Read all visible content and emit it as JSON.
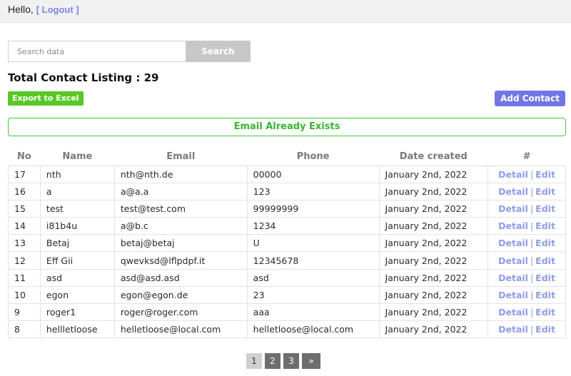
{
  "header": {
    "greeting": "Hello,",
    "logout_open": "[",
    "logout_label": "Logout",
    "logout_close": "]"
  },
  "search": {
    "placeholder": "Search data",
    "value": "",
    "button_label": "Search"
  },
  "total": {
    "label": "Total Contact Listing : 29"
  },
  "actions": {
    "export_label": "Export to Excel",
    "add_label": "Add Contact"
  },
  "alert": {
    "message": "Email Already Exists"
  },
  "table": {
    "headers": [
      "No",
      "Name",
      "Email",
      "Phone",
      "Date created",
      "#"
    ],
    "detail_label": "Detail",
    "separator": "|",
    "edit_label": "Edit",
    "rows": [
      {
        "no": "17",
        "name": "nth",
        "email": "nth@nth.de",
        "phone": "00000",
        "date": "January 2nd, 2022"
      },
      {
        "no": "16",
        "name": "a",
        "email": "a@a.a",
        "phone": "123",
        "date": "January 2nd, 2022"
      },
      {
        "no": "15",
        "name": "test",
        "email": "test@test.com",
        "phone": "99999999",
        "date": "January 2nd, 2022"
      },
      {
        "no": "14",
        "name": "i81b4u",
        "email": "a@b.c",
        "phone": "1234",
        "date": "January 2nd, 2022"
      },
      {
        "no": "13",
        "name": "Betaj",
        "email": "betaj@betaj",
        "phone": "U",
        "date": "January 2nd, 2022"
      },
      {
        "no": "12",
        "name": "Eff Gii",
        "email": "qwevksd@lflpdpf.it",
        "phone": "12345678",
        "date": "January 2nd, 2022"
      },
      {
        "no": "11",
        "name": "asd",
        "email": "asd@asd.asd",
        "phone": "asd",
        "date": "January 2nd, 2022"
      },
      {
        "no": "10",
        "name": "egon",
        "email": "egon@egon.de",
        "phone": "23",
        "date": "January 2nd, 2022"
      },
      {
        "no": "9",
        "name": "roger1",
        "email": "roger@roger.com",
        "phone": "aaa",
        "date": "January 2nd, 2022"
      },
      {
        "no": "8",
        "name": "hellletloose",
        "email": "helletloose@local.com",
        "phone": "helletloose@local.com",
        "date": "January 2nd, 2022"
      }
    ]
  },
  "pagination": {
    "pages": [
      "1",
      "2",
      "3"
    ],
    "current": "1",
    "next_label": "»"
  },
  "colors": {
    "accent": "#7077e4",
    "success": "#59c724",
    "link": "#8f9ce6"
  }
}
